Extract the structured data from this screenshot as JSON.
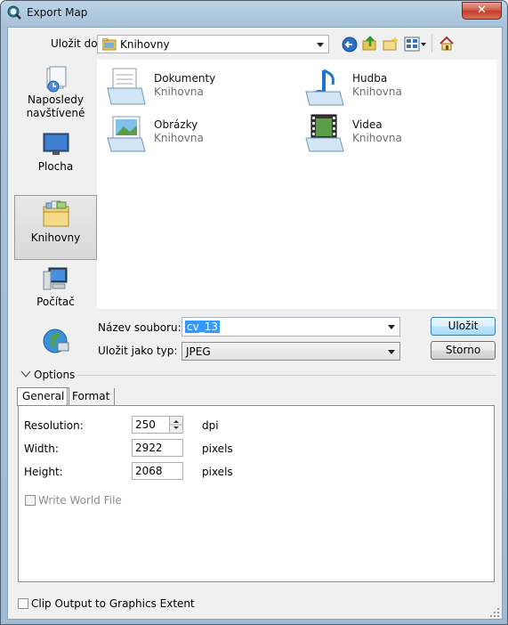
{
  "window": {
    "title": "Export Map",
    "close_label": "✕"
  },
  "toolbar": {
    "save_in_label": "Uložit do:",
    "location_value": "Knihovny"
  },
  "places": [
    {
      "label": "Naposledy navštívené",
      "icon": "recent-places-icon"
    },
    {
      "label": "Plocha",
      "icon": "desktop-icon"
    },
    {
      "label": "Knihovny",
      "icon": "libraries-icon",
      "selected": true
    },
    {
      "label": "Počítač",
      "icon": "computer-icon"
    },
    {
      "label": "",
      "icon": "network-icon"
    }
  ],
  "items": [
    {
      "name": "Dokumenty",
      "sub": "Knihovna",
      "icon": "documents-library-icon"
    },
    {
      "name": "Hudba",
      "sub": "Knihovna",
      "icon": "music-library-icon"
    },
    {
      "name": "Obrázky",
      "sub": "Knihovna",
      "icon": "pictures-library-icon"
    },
    {
      "name": "Videa",
      "sub": "Knihovna",
      "icon": "videos-library-icon"
    }
  ],
  "form": {
    "filename_label": "Název souboru:",
    "filename_value": "cv_13",
    "filetype_label": "Uložit jako typ:",
    "filetype_value": "JPEG",
    "save_button": "Uložit",
    "cancel_button": "Storno"
  },
  "options": {
    "header": "Options",
    "tabs": [
      "General",
      "Format"
    ],
    "resolution_label": "Resolution:",
    "resolution_value": "250",
    "resolution_unit": "dpi",
    "width_label": "Width:",
    "width_value": "2922",
    "width_unit": "pixels",
    "height_label": "Height:",
    "height_value": "2068",
    "height_unit": "pixels",
    "world_file_label": "Write World File",
    "clip_label": "Clip Output to Graphics Extent"
  },
  "colors": {
    "selection": "#3399ff",
    "title_bg": "#bcd3e6",
    "close": "#c4402b"
  }
}
